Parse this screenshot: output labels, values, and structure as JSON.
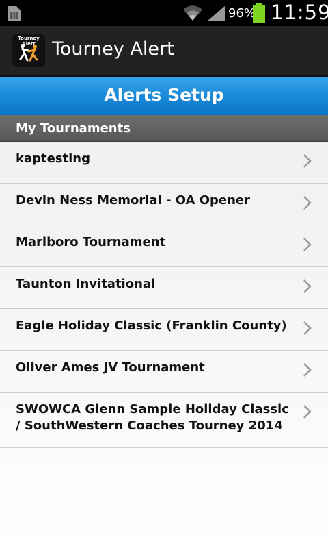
{
  "status_bar": {
    "battery_percent": "96%",
    "time": "11:59",
    "icons": [
      "sim-card-icon",
      "wifi-icon",
      "signal-icon",
      "battery-icon"
    ]
  },
  "action_bar": {
    "app_icon_text": "Tourney Alert",
    "title": "Tourney Alert"
  },
  "header": {
    "title": "Alerts Setup"
  },
  "section": {
    "title": "My Tournaments"
  },
  "tournaments": [
    {
      "label": "kaptesting"
    },
    {
      "label": "Devin Ness Memorial - OA Opener"
    },
    {
      "label": "Marlboro Tournament"
    },
    {
      "label": "Taunton Invitational"
    },
    {
      "label": "Eagle Holiday Classic (Franklin County)"
    },
    {
      "label": "Oliver Ames JV Tournament"
    },
    {
      "label": "SWOWCA Glenn Sample Holiday Classic / SouthWestern Coaches Tourney 2014"
    }
  ],
  "colors": {
    "header_blue": "#1a8ad9",
    "battery_green": "#7ed321",
    "section_gray": "#5f5f5f"
  }
}
